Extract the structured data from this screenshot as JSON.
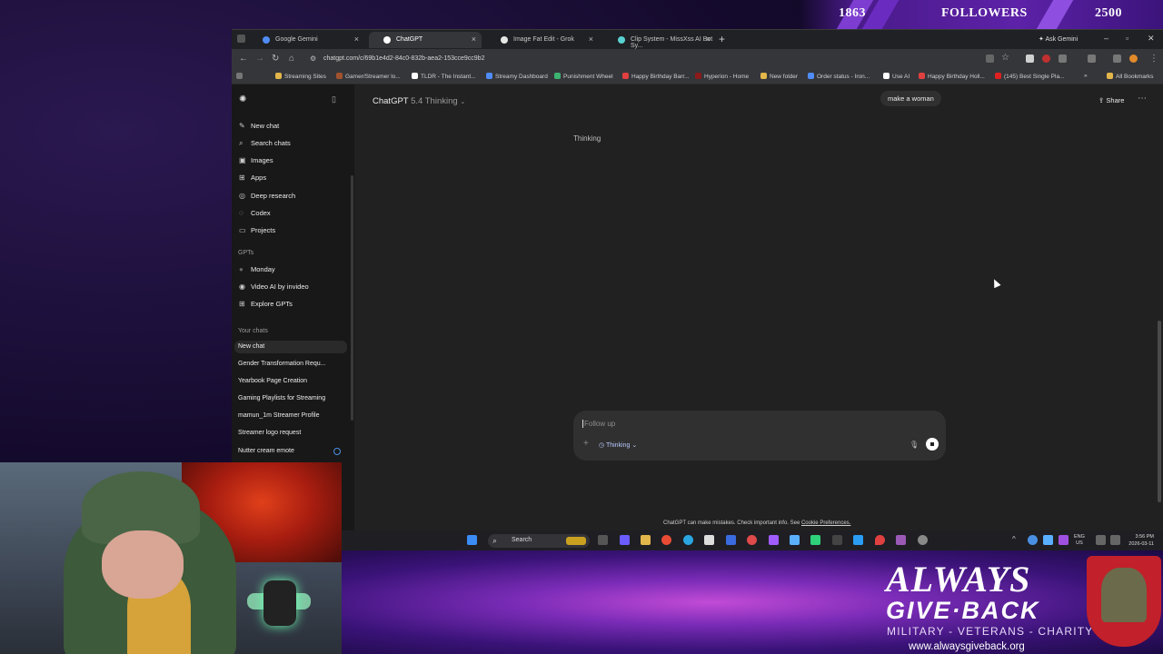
{
  "overlay": {
    "followers_current": "1863",
    "followers_label": "FOLLOWERS",
    "followers_goal": "2500",
    "logo_line1": "ALWAYS",
    "logo_line2": "GIVE·BACK",
    "logo_line3": "MILITARY - VETERANS - CHARITY",
    "logo_url": "www.alwaysgiveback.org"
  },
  "browser": {
    "tabs": [
      {
        "label": "Google Gemini",
        "color": "#4f8cf7"
      },
      {
        "label": "ChatGPT",
        "color": "#ffffff"
      },
      {
        "label": "Image Fat Edit - Grok",
        "color": "#e6e6e6"
      },
      {
        "label": "Clip System - MissXss AI Bot Sy...",
        "color": "#5ad1d1"
      }
    ],
    "ask_gemini": "Ask Gemini",
    "url": "chatgpt.com/c/69b1e4d2-84c0-832b-aea2-153cce9cc9b2",
    "bookmarks": [
      {
        "label": "Streaming Sites",
        "color": "#e2b64a"
      },
      {
        "label": "Gamer/Streamer lo...",
        "color": "#a0522d"
      },
      {
        "label": "TLDR - The Instant...",
        "color": "#ffffff"
      },
      {
        "label": "Streamy Dashboard",
        "color": "#4f8cf7"
      },
      {
        "label": "Punishment Wheel",
        "color": "#3cb371"
      },
      {
        "label": "Happy Birthday Barr...",
        "color": "#e04040"
      },
      {
        "label": "Hyperion - Home",
        "color": "#8b1a1a"
      },
      {
        "label": "New folder",
        "color": "#e2b64a"
      },
      {
        "label": "Order status - Iron...",
        "color": "#4f8cf7"
      },
      {
        "label": "Use AI",
        "color": "#ffffff"
      },
      {
        "label": "Happy Birthday Holl...",
        "color": "#e04040"
      },
      {
        "label": "(145) Best Single Pla...",
        "color": "#e02020"
      }
    ],
    "all_bookmarks": "All Bookmarks"
  },
  "sidebar": {
    "nav": [
      {
        "label": "New chat",
        "icon": "pencil-icon",
        "glyph": "✎"
      },
      {
        "label": "Search chats",
        "icon": "search-icon",
        "glyph": "⌕"
      },
      {
        "label": "Images",
        "icon": "image-icon",
        "glyph": "▣"
      },
      {
        "label": "Apps",
        "icon": "apps-icon",
        "glyph": "⊞"
      },
      {
        "label": "Deep research",
        "icon": "research-icon",
        "glyph": "◎"
      },
      {
        "label": "Codex",
        "icon": "codex-icon",
        "glyph": "◌"
      },
      {
        "label": "Projects",
        "icon": "folder-icon",
        "glyph": "▭"
      }
    ],
    "gpts_heading": "GPTs",
    "gpts": [
      {
        "label": "Monday",
        "icon": "monday-icon",
        "glyph": "●"
      },
      {
        "label": "Video AI by invideo",
        "icon": "invideo-icon",
        "glyph": "◉"
      },
      {
        "label": "Explore GPTs",
        "icon": "explore-icon",
        "glyph": "⊞"
      }
    ],
    "chats_heading": "Your chats",
    "chats": [
      "New chat",
      "Gender Transformation Requ...",
      "Yearbook Page Creation",
      "Gaming Playlists for Streaming",
      "mamun_1m Streamer Profile",
      "Streamer logo request",
      "Nutter cream emote"
    ]
  },
  "main": {
    "model_name": "ChatGPT",
    "model_version": "5.4 Thinking",
    "user_message": "make a woman",
    "status": "Thinking",
    "share_label": "Share",
    "composer_placeholder": "Follow up",
    "mode_label": "Thinking",
    "disclaimer": "ChatGPT can make mistakes. Check important info. See",
    "cookie_link": "Cookie Preferences."
  },
  "taskbar": {
    "search_label": "Search",
    "lang_top": "ENG",
    "lang_bottom": "US",
    "time": "3:56 PM",
    "date": "2026-03-11"
  }
}
